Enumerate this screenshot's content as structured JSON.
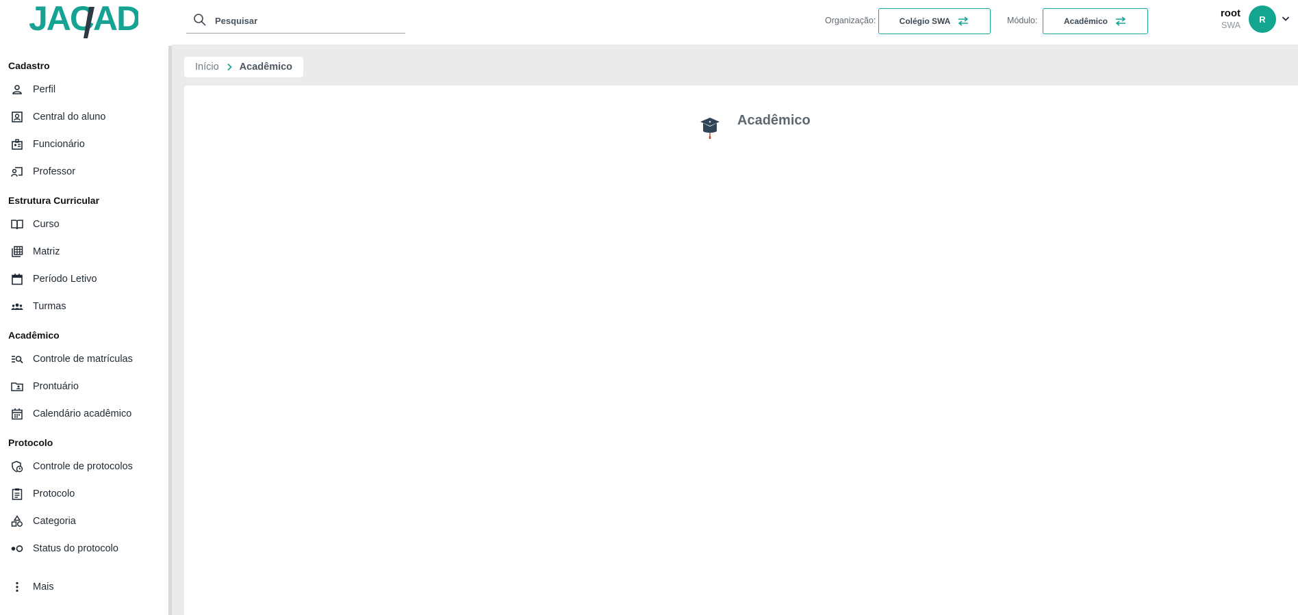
{
  "app": {
    "logo_text": "JACAD"
  },
  "search": {
    "placeholder": "Pesquisar"
  },
  "header": {
    "org_label": "Organização:",
    "org_value": "Colégio SWA",
    "module_label": "Módulo:",
    "module_value": "Acadêmico",
    "user_name": "root",
    "user_org": "SWA",
    "avatar_initial": "R"
  },
  "colors": {
    "brand": "#16a394",
    "avatar": "#13a58f",
    "breadcrumb_chevron": "#16a394"
  },
  "sidebar": {
    "sections": [
      {
        "title": "Cadastro",
        "items": [
          {
            "label": "Perfil",
            "icon": "person-icon"
          },
          {
            "label": "Central do aluno",
            "icon": "student-portrait-icon"
          },
          {
            "label": "Funcionário",
            "icon": "employee-badge-icon"
          },
          {
            "label": "Professor",
            "icon": "teacher-board-icon"
          }
        ]
      },
      {
        "title": "Estrutura Curricular",
        "items": [
          {
            "label": "Curso",
            "icon": "open-book-icon"
          },
          {
            "label": "Matriz",
            "icon": "matrix-grid-icon"
          },
          {
            "label": "Período Letivo",
            "icon": "calendar-icon"
          },
          {
            "label": "Turmas",
            "icon": "group-icon"
          }
        ]
      },
      {
        "title": "Acadêmico",
        "items": [
          {
            "label": "Controle de matrículas",
            "icon": "list-search-icon"
          },
          {
            "label": "Prontuário",
            "icon": "folder-person-icon"
          },
          {
            "label": "Calendário acadêmico",
            "icon": "calendar-grid-icon"
          }
        ]
      },
      {
        "title": "Protocolo",
        "items": [
          {
            "label": "Controle de protocolos",
            "icon": "shield-clock-icon"
          },
          {
            "label": "Protocolo",
            "icon": "clipboard-icon"
          },
          {
            "label": "Categoria",
            "icon": "shapes-icon"
          },
          {
            "label": "Status do protocolo",
            "icon": "status-dots-icon"
          }
        ]
      }
    ],
    "more_label": "Mais"
  },
  "breadcrumb": {
    "home": "Início",
    "current": "Acadêmico"
  },
  "main": {
    "title": "Acadêmico",
    "icon": "graduation-cap-icon"
  }
}
